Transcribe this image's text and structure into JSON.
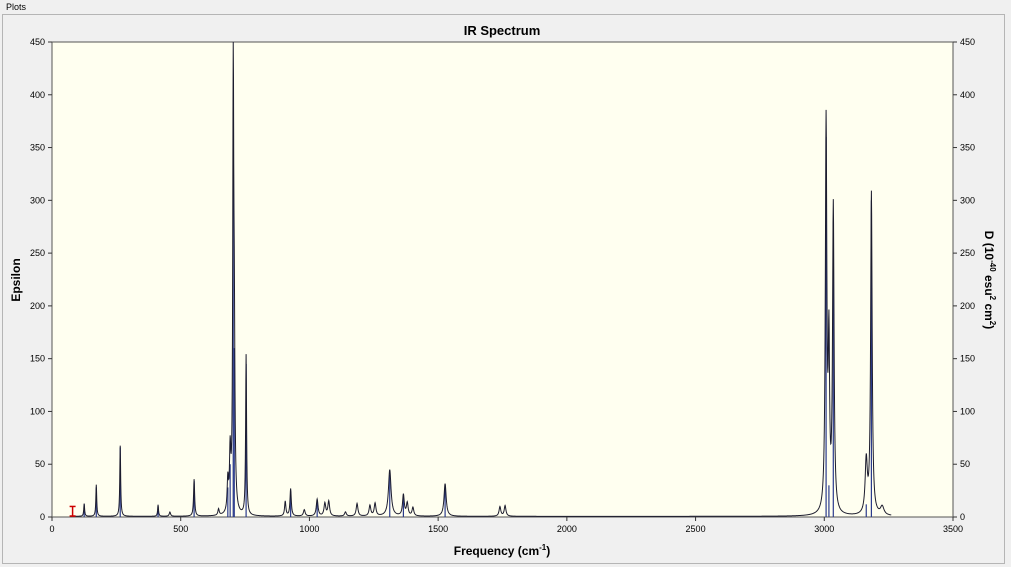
{
  "window": {
    "title": "Plots"
  },
  "chart_data": {
    "type": "line",
    "title": "IR Spectrum",
    "xlabel": "Frequency (cm",
    "xlabel_sup": "-1",
    "xlabel_close": ")",
    "ylabel": "Epsilon",
    "y2label_parts": [
      "D (10",
      "-40",
      " esu",
      "2",
      " cm",
      "2",
      ")"
    ],
    "xlim": [
      0,
      3500
    ],
    "ylim": [
      0,
      450
    ],
    "y2lim": [
      0,
      450
    ],
    "x_ticks": [
      0,
      500,
      1000,
      1500,
      2000,
      2500,
      3000,
      3500
    ],
    "y_ticks": [
      0,
      50,
      100,
      150,
      200,
      250,
      300,
      350,
      400,
      450
    ],
    "y2_ticks": [
      0,
      50,
      100,
      150,
      200,
      250,
      300,
      350,
      400,
      450
    ],
    "grid": false,
    "colors": {
      "plot_bg": "#fffff0",
      "line": "#1c1c2e",
      "stick": "#2a3a8c",
      "marker": "#cc0000"
    },
    "peaks": [
      {
        "x": 125,
        "y": 12,
        "w": 2
      },
      {
        "x": 172,
        "y": 30,
        "w": 2
      },
      {
        "x": 265,
        "y": 67,
        "w": 2
      },
      {
        "x": 412,
        "y": 11,
        "w": 2
      },
      {
        "x": 458,
        "y": 4,
        "w": 3
      },
      {
        "x": 552,
        "y": 35,
        "w": 2.5
      },
      {
        "x": 647,
        "y": 6,
        "w": 3
      },
      {
        "x": 683,
        "y": 30,
        "w": 3
      },
      {
        "x": 692,
        "y": 55,
        "w": 3
      },
      {
        "x": 704,
        "y": 402,
        "w": 2.2
      },
      {
        "x": 708,
        "y": 160,
        "w": 3
      },
      {
        "x": 754,
        "y": 152,
        "w": 2.2
      },
      {
        "x": 906,
        "y": 14,
        "w": 3
      },
      {
        "x": 927,
        "y": 26,
        "w": 3
      },
      {
        "x": 980,
        "y": 6,
        "w": 4
      },
      {
        "x": 1030,
        "y": 16,
        "w": 4
      },
      {
        "x": 1060,
        "y": 12,
        "w": 4
      },
      {
        "x": 1075,
        "y": 14,
        "w": 4
      },
      {
        "x": 1140,
        "y": 4,
        "w": 4
      },
      {
        "x": 1185,
        "y": 12,
        "w": 4
      },
      {
        "x": 1235,
        "y": 10,
        "w": 4
      },
      {
        "x": 1255,
        "y": 12,
        "w": 4
      },
      {
        "x": 1312,
        "y": 44,
        "w": 6
      },
      {
        "x": 1365,
        "y": 20,
        "w": 4
      },
      {
        "x": 1380,
        "y": 12,
        "w": 4
      },
      {
        "x": 1402,
        "y": 8,
        "w": 4
      },
      {
        "x": 1527,
        "y": 31,
        "w": 5
      },
      {
        "x": 1740,
        "y": 9,
        "w": 4
      },
      {
        "x": 1760,
        "y": 10,
        "w": 4
      },
      {
        "x": 3007,
        "y": 370,
        "w": 3.5
      },
      {
        "x": 3018,
        "y": 150,
        "w": 3
      },
      {
        "x": 3035,
        "y": 290,
        "w": 3.5
      },
      {
        "x": 3163,
        "y": 50,
        "w": 5
      },
      {
        "x": 3183,
        "y": 305,
        "w": 3.5
      },
      {
        "x": 3225,
        "y": 8,
        "w": 8
      }
    ],
    "sticks": [
      {
        "x": 125,
        "y": 12
      },
      {
        "x": 172,
        "y": 28
      },
      {
        "x": 265,
        "y": 66
      },
      {
        "x": 412,
        "y": 10
      },
      {
        "x": 552,
        "y": 34
      },
      {
        "x": 683,
        "y": 28
      },
      {
        "x": 692,
        "y": 50
      },
      {
        "x": 704,
        "y": 395
      },
      {
        "x": 708,
        "y": 160
      },
      {
        "x": 754,
        "y": 145
      },
      {
        "x": 927,
        "y": 24
      },
      {
        "x": 1030,
        "y": 15
      },
      {
        "x": 1312,
        "y": 40
      },
      {
        "x": 1365,
        "y": 18
      },
      {
        "x": 1527,
        "y": 30
      },
      {
        "x": 3007,
        "y": 360
      },
      {
        "x": 3018,
        "y": 30
      },
      {
        "x": 3035,
        "y": 280
      },
      {
        "x": 3163,
        "y": 12
      },
      {
        "x": 3183,
        "y": 300
      }
    ],
    "marker": {
      "x": 80,
      "y": 10
    }
  }
}
